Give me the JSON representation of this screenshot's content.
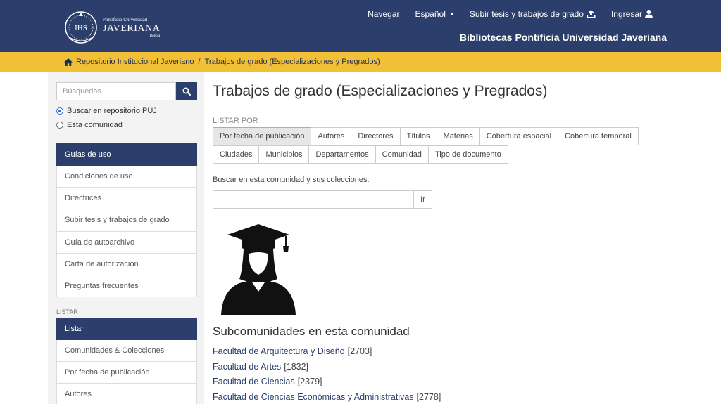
{
  "header": {
    "logo": {
      "line1": "Pontificia Universidad",
      "line2": "JAVERIANA",
      "line3": "Bogotá"
    },
    "nav": [
      {
        "label": "Navegar"
      },
      {
        "label": "Español"
      },
      {
        "label": "Subir tesis y trabajos de grado"
      },
      {
        "label": "Ingresar"
      }
    ],
    "site_title": "Bibliotecas Pontificia Universidad Javeriana"
  },
  "breadcrumb": {
    "home": "Repositorio Institucional Javeriano",
    "current": "Trabajos de grado (Especializaciones y Pregrados)"
  },
  "sidebar": {
    "search_placeholder": "Búsquedas",
    "scope_options": [
      {
        "label": "Buscar en repositorio PUJ",
        "selected": true
      },
      {
        "label": "Esta comunidad",
        "selected": false
      }
    ],
    "guides_header": "Guías de uso",
    "guides": [
      "Condiciones de uso",
      "Directrices",
      "Subir tesis y trabajos de grado",
      "Guía de autoarchivo",
      "Carta de autorización",
      "Preguntas frecuentes"
    ],
    "list_section_label": "LISTAR",
    "list_header": "Listar",
    "list_items": [
      "Comunidades & Colecciones",
      "Por fecha de publicación",
      "Autores"
    ]
  },
  "main": {
    "title": "Trabajos de grado (Especializaciones y Pregrados)",
    "browse_label": "LISTAR POR",
    "browse_row1": [
      "Por fecha de publicación",
      "Autores",
      "Directores",
      "Títulos",
      "Materias",
      "Cobertura espacial",
      "Cobertura temporal"
    ],
    "browse_row2": [
      "Ciudades",
      "Municipios",
      "Departamentos",
      "Comunidad",
      "Tipo de documento"
    ],
    "search_label": "Buscar en esta comunidad y sus colecciones:",
    "search_button": "Ir",
    "image_icon": "graduate-icon",
    "subcommunities_title": "Subcomunidades en esta comunidad",
    "subcommunities": [
      {
        "name": "Facultad de Arquitectura y Diseño",
        "count": "[2703]"
      },
      {
        "name": "Facultad de Artes",
        "count": "[1832]"
      },
      {
        "name": "Facultad de Ciencias",
        "count": "[2379]"
      },
      {
        "name": "Facultad de Ciencias Económicas y Administrativas",
        "count": "[2778]"
      }
    ]
  },
  "colors": {
    "navy": "#2c3e6b",
    "gold": "#f2c037"
  }
}
